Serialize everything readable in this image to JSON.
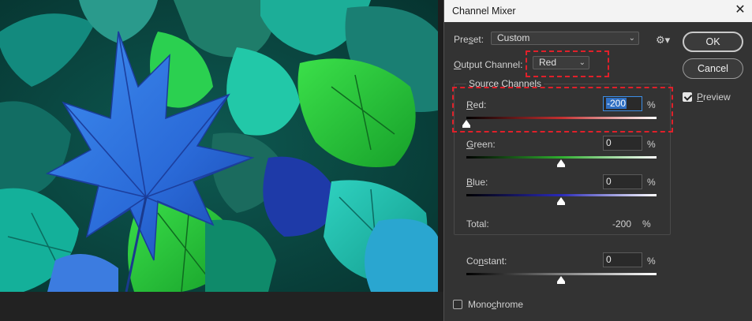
{
  "window": {
    "title": "Channel Mixer",
    "close_glyph": "✕"
  },
  "preset": {
    "label_prefix": "Pre",
    "label_mnemonic": "s",
    "label_suffix": "et:",
    "value": "Custom"
  },
  "output_channel": {
    "label_mnemonic": "O",
    "label_rest": "utput Channel:",
    "value": "Red"
  },
  "source_channels": {
    "title": "Source Channels",
    "red": {
      "label_mnemonic": "R",
      "label_rest": "ed:",
      "value": "-200",
      "percent": -200
    },
    "green": {
      "label_mnemonic": "G",
      "label_rest": "reen:",
      "value": "0",
      "percent": 0
    },
    "blue": {
      "label_mnemonic": "B",
      "label_rest": "lue:",
      "value": "0",
      "percent": 0
    },
    "total": {
      "label": "Total:",
      "value": "-200"
    }
  },
  "constant": {
    "label_prefix": "Co",
    "label_mnemonic": "n",
    "label_suffix": "stant:",
    "value": "0",
    "percent": 0
  },
  "monochrome": {
    "label_prefix": "Mono",
    "label_mnemonic": "c",
    "label_suffix": "hrome",
    "checked": false
  },
  "buttons": {
    "ok": "OK",
    "cancel": "Cancel"
  },
  "preview": {
    "label_mnemonic": "P",
    "label_rest": "review",
    "checked": true
  },
  "percent_sign": "%",
  "icons": {
    "settings": "gear-icon",
    "dropdown": "chevron-down-icon",
    "close": "close-icon"
  },
  "colors": {
    "highlight": "#e0202a",
    "focus": "#3d8ee6",
    "selection": "#2f6fc3"
  }
}
